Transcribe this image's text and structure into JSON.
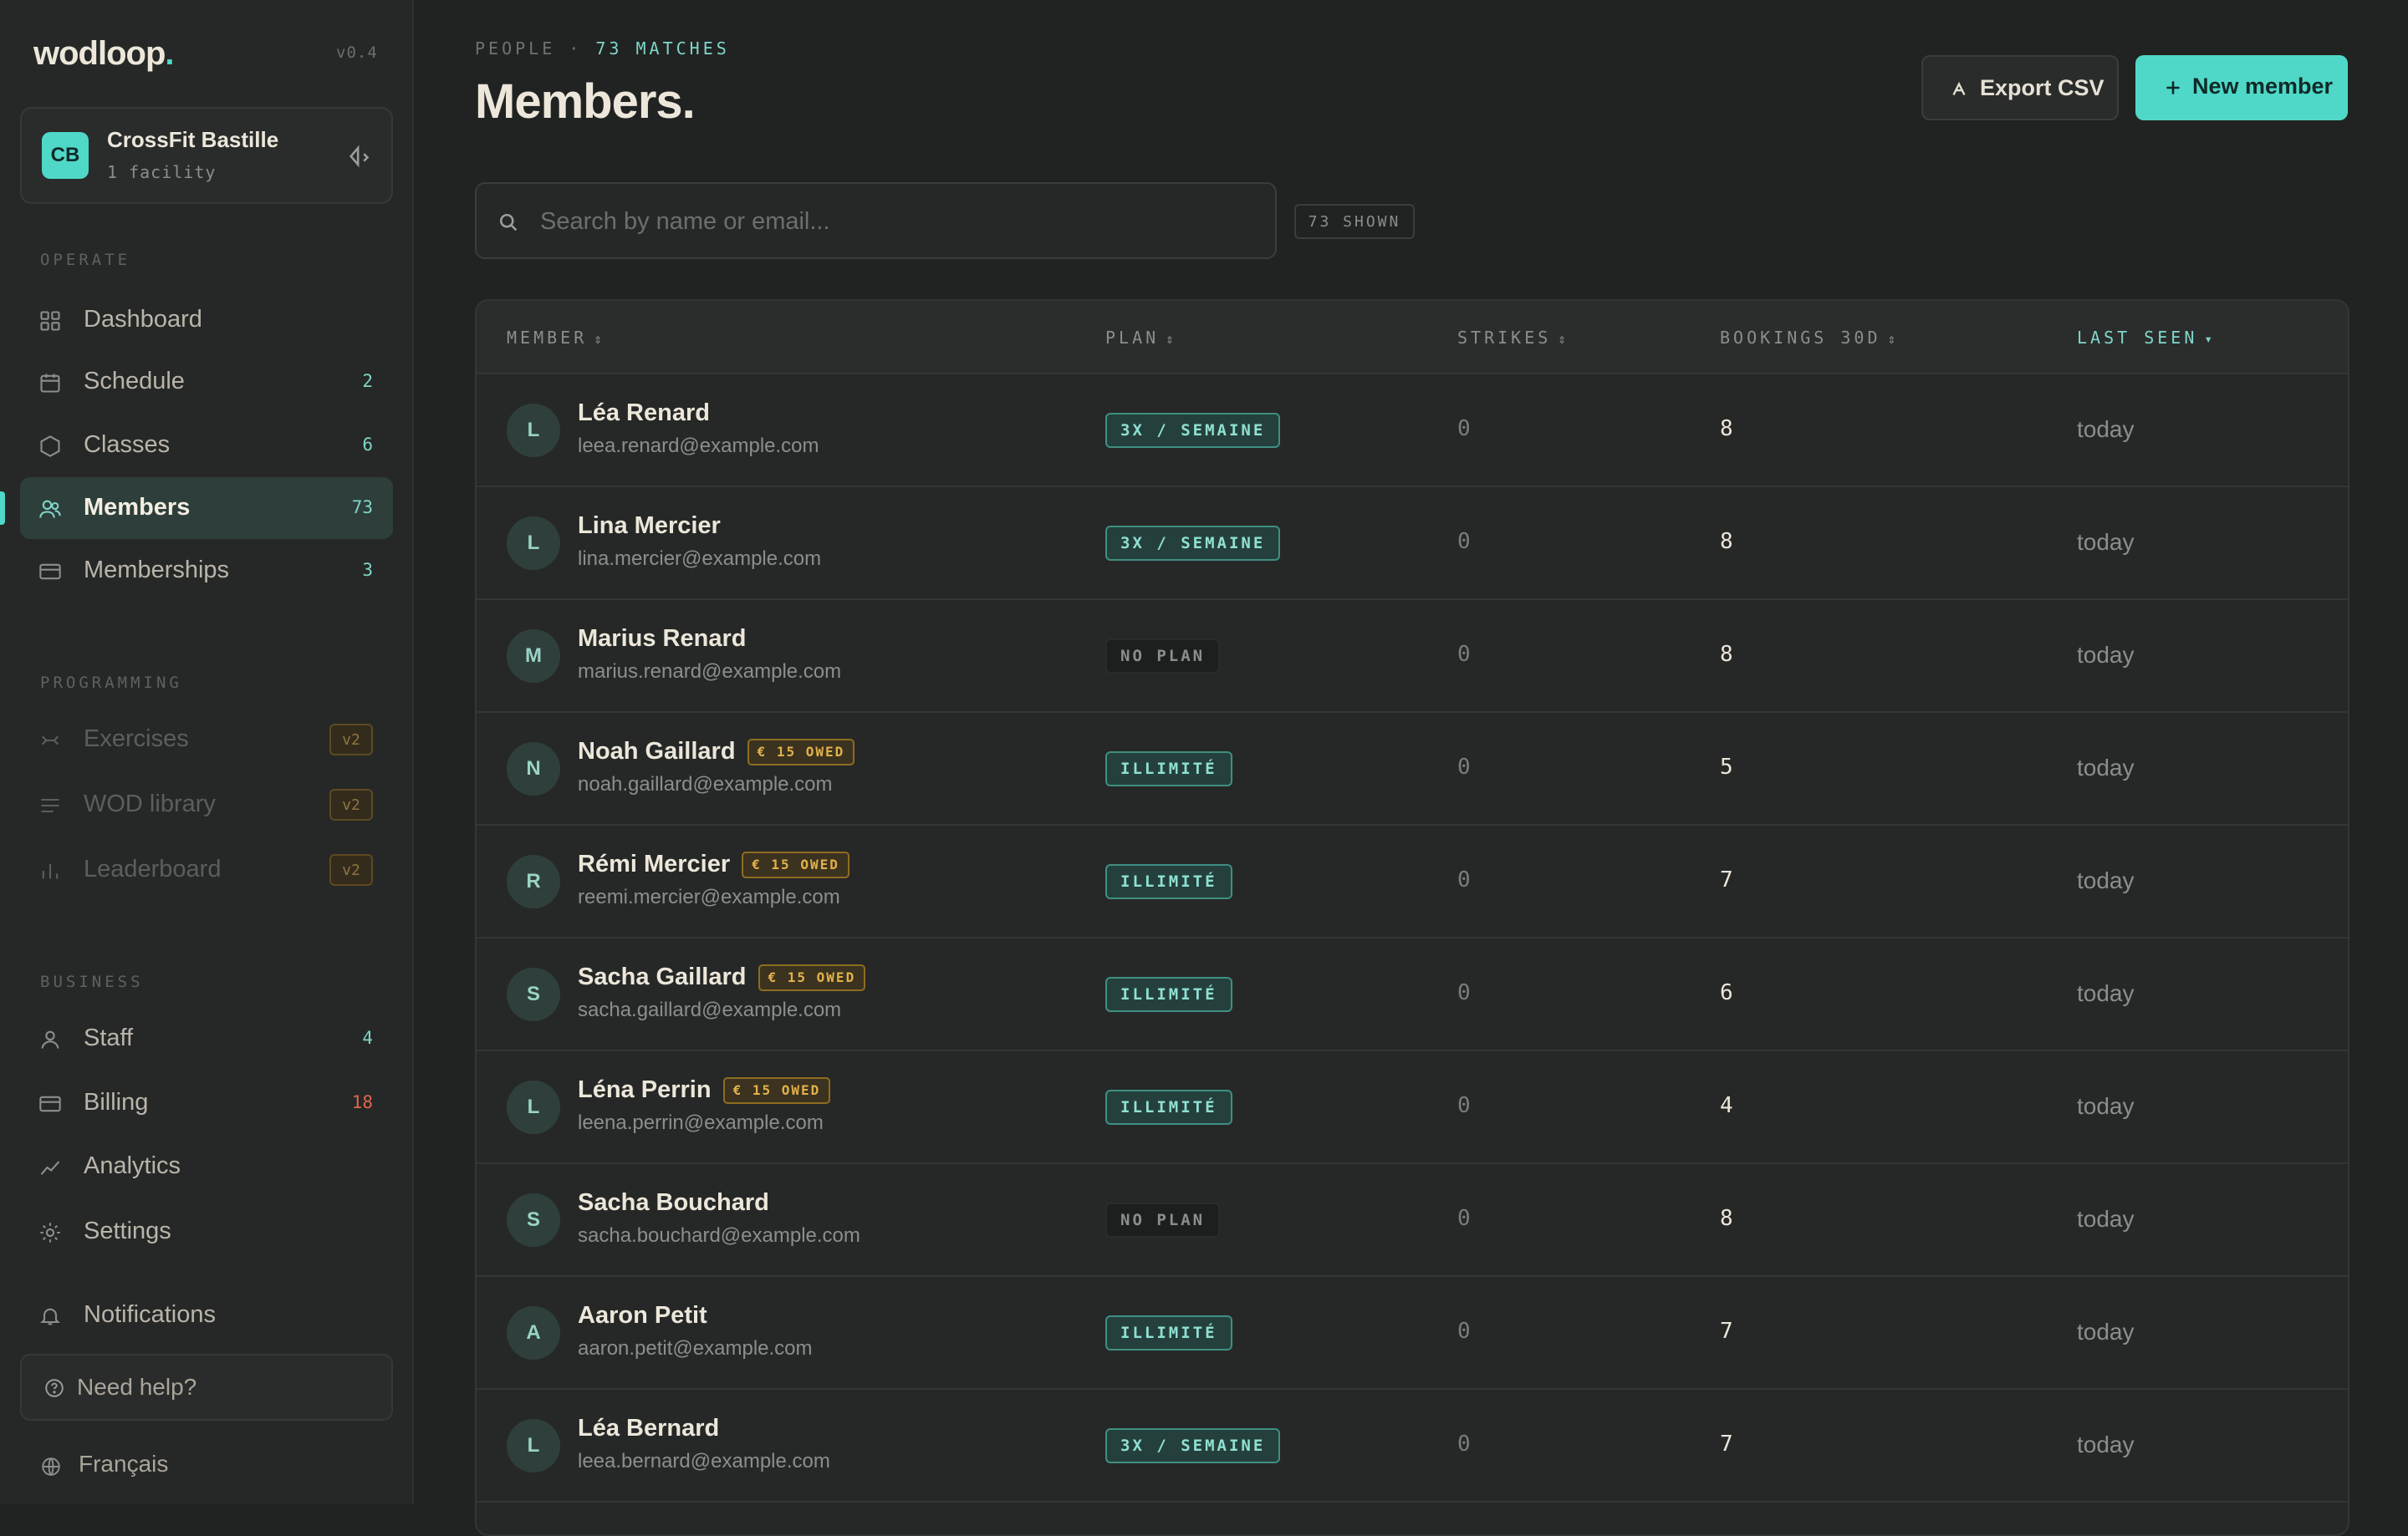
{
  "brand": {
    "name": "wodloop",
    "dot": ".",
    "version": "v0.4"
  },
  "org": {
    "initials": "CB",
    "name": "CrossFit Bastille",
    "sub": "1 facility"
  },
  "sections": {
    "operate": "OPERATE",
    "programming": "PROGRAMMING",
    "business": "BUSINESS"
  },
  "nav": {
    "dashboard": {
      "label": "Dashboard",
      "icon": "grid-icon"
    },
    "schedule": {
      "label": "Schedule",
      "count": "2",
      "icon": "calendar-icon"
    },
    "classes": {
      "label": "Classes",
      "count": "6",
      "icon": "hexagon-icon"
    },
    "members": {
      "label": "Members",
      "count": "73",
      "icon": "users-icon"
    },
    "memberships": {
      "label": "Memberships",
      "count": "3",
      "icon": "card-icon"
    },
    "exercises": {
      "label": "Exercises",
      "badge": "v2",
      "icon": "dumbbell-icon"
    },
    "wod": {
      "label": "WOD library",
      "badge": "v2",
      "icon": "list-icon"
    },
    "leaderboard": {
      "label": "Leaderboard",
      "badge": "v2",
      "icon": "bar-chart-icon"
    },
    "staff": {
      "label": "Staff",
      "count": "4",
      "icon": "user-icon"
    },
    "billing": {
      "label": "Billing",
      "count": "18",
      "icon": "card-icon"
    },
    "analytics": {
      "label": "Analytics",
      "icon": "trend-icon"
    },
    "settings": {
      "label": "Settings",
      "icon": "gear-icon"
    },
    "notifications": {
      "label": "Notifications",
      "icon": "bell-icon"
    }
  },
  "help": {
    "label": "Need help?"
  },
  "language": {
    "label": "Français"
  },
  "header": {
    "crumb": "PEOPLE",
    "sep": "·",
    "matches": "73 MATCHES",
    "title": "Members."
  },
  "actions": {
    "export": "Export CSV",
    "new_member": "New member"
  },
  "search": {
    "placeholder": "Search by name or email...",
    "value": "",
    "shown": "73 SHOWN"
  },
  "columns": {
    "member": "MEMBER",
    "plan": "PLAN",
    "strikes": "STRIKES",
    "bookings": "BOOKINGS 30D",
    "last_seen": "LAST SEEN"
  },
  "colors": {
    "accent": "#4fd8c8",
    "owed": "#e3b14a",
    "alert": "#e0664f"
  },
  "members": [
    {
      "initial": "L",
      "name": "Léa Renard",
      "email": "leea.renard@example.com",
      "owed": "",
      "plan": "3X / SEMAINE",
      "plan_kind": "teal",
      "strikes": "0",
      "bookings": "8",
      "last_seen": "today"
    },
    {
      "initial": "L",
      "name": "Lina Mercier",
      "email": "lina.mercier@example.com",
      "owed": "",
      "plan": "3X / SEMAINE",
      "plan_kind": "teal",
      "strikes": "0",
      "bookings": "8",
      "last_seen": "today"
    },
    {
      "initial": "M",
      "name": "Marius Renard",
      "email": "marius.renard@example.com",
      "owed": "",
      "plan": "NO PLAN",
      "plan_kind": "none",
      "strikes": "0",
      "bookings": "8",
      "last_seen": "today"
    },
    {
      "initial": "N",
      "name": "Noah Gaillard",
      "email": "noah.gaillard@example.com",
      "owed": "€ 15 OWED",
      "plan": "ILLIMITÉ",
      "plan_kind": "teal",
      "strikes": "0",
      "bookings": "5",
      "last_seen": "today"
    },
    {
      "initial": "R",
      "name": "Rémi Mercier",
      "email": "reemi.mercier@example.com",
      "owed": "€ 15 OWED",
      "plan": "ILLIMITÉ",
      "plan_kind": "teal",
      "strikes": "0",
      "bookings": "7",
      "last_seen": "today"
    },
    {
      "initial": "S",
      "name": "Sacha Gaillard",
      "email": "sacha.gaillard@example.com",
      "owed": "€ 15 OWED",
      "plan": "ILLIMITÉ",
      "plan_kind": "teal",
      "strikes": "0",
      "bookings": "6",
      "last_seen": "today"
    },
    {
      "initial": "L",
      "name": "Léna Perrin",
      "email": "leena.perrin@example.com",
      "owed": "€ 15 OWED",
      "plan": "ILLIMITÉ",
      "plan_kind": "teal",
      "strikes": "0",
      "bookings": "4",
      "last_seen": "today"
    },
    {
      "initial": "S",
      "name": "Sacha Bouchard",
      "email": "sacha.bouchard@example.com",
      "owed": "",
      "plan": "NO PLAN",
      "plan_kind": "none",
      "strikes": "0",
      "bookings": "8",
      "last_seen": "today"
    },
    {
      "initial": "A",
      "name": "Aaron Petit",
      "email": "aaron.petit@example.com",
      "owed": "",
      "plan": "ILLIMITÉ",
      "plan_kind": "teal",
      "strikes": "0",
      "bookings": "7",
      "last_seen": "today"
    },
    {
      "initial": "L",
      "name": "Léa Bernard",
      "email": "leea.bernard@example.com",
      "owed": "",
      "plan": "3X / SEMAINE",
      "plan_kind": "teal",
      "strikes": "0",
      "bookings": "7",
      "last_seen": "today"
    }
  ]
}
